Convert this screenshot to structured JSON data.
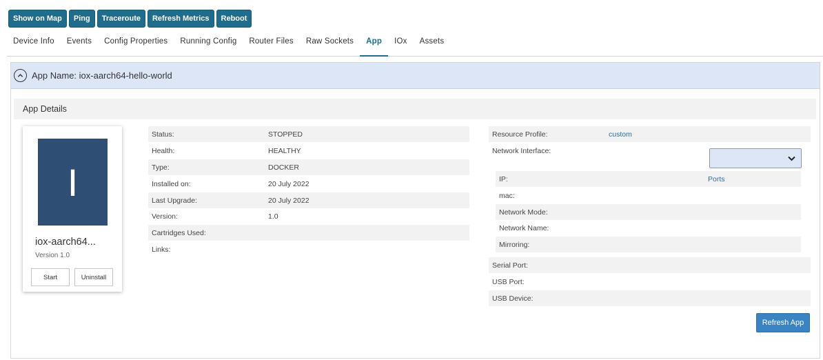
{
  "toolbar": {
    "buttons": [
      "Show on Map",
      "Ping",
      "Traceroute",
      "Refresh Metrics",
      "Reboot"
    ]
  },
  "tabs": {
    "items": [
      "Device Info",
      "Events",
      "Config Properties",
      "Running Config",
      "Router Files",
      "Raw Sockets",
      "App",
      "IOx",
      "Assets"
    ],
    "active": "App"
  },
  "app": {
    "header": "App Name: iox-aarch64-hello-world",
    "details_title": "App Details",
    "card": {
      "icon_letter": "I",
      "name": "iox-aarch64...",
      "version": "Version 1.0",
      "start_label": "Start",
      "uninstall_label": "Uninstall"
    },
    "details": [
      {
        "label": "Status:",
        "value": "STOPPED"
      },
      {
        "label": "Health:",
        "value": "HEALTHY"
      },
      {
        "label": "Type:",
        "value": "DOCKER"
      },
      {
        "label": "Installed on:",
        "value": "20 July 2022"
      },
      {
        "label": "Last Upgrade:",
        "value": "20 July 2022"
      },
      {
        "label": "Version:",
        "value": "1.0"
      },
      {
        "label": "Cartridges Used:",
        "value": ""
      },
      {
        "label": "Links:",
        "value": ""
      }
    ],
    "resources": {
      "resource_profile_label": "Resource Profile:",
      "resource_profile_value": "custom",
      "network_interface_label": "Network Interface:",
      "network_interface_value": "",
      "network": [
        {
          "label": "IP:",
          "value": "Ports"
        },
        {
          "label": "mac:",
          "value": ""
        },
        {
          "label": "Network Mode:",
          "value": ""
        },
        {
          "label": "Network Name:",
          "value": ""
        },
        {
          "label": "Mirroring:",
          "value": ""
        }
      ],
      "ports": [
        {
          "label": "Serial Port:"
        },
        {
          "label": "USB Port:"
        },
        {
          "label": "USB Device:"
        }
      ]
    },
    "refresh_label": "Refresh App"
  }
}
